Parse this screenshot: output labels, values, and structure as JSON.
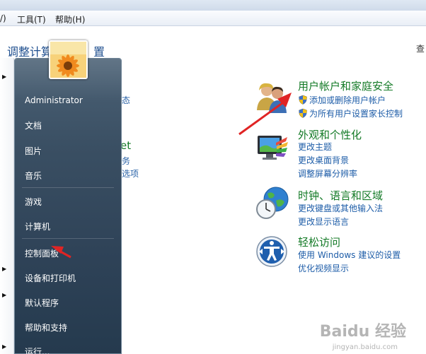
{
  "menubar": {
    "view_fragment": "/)",
    "tools": "工具(T)",
    "help": "帮助(H)"
  },
  "page": {
    "title_left": "调整计算",
    "title_right": "置",
    "right_edge_glyph": "查"
  },
  "categories": [
    {
      "title": "用户帐户和家庭安全",
      "icon": "users-icon",
      "links": [
        "添加或删除用户帐户",
        "为所有用户设置家长控制"
      ],
      "shield_links": true
    },
    {
      "title": "外观和个性化",
      "icon": "appearance-icon",
      "links": [
        "更改主题",
        "更改桌面背景",
        "调整屏幕分辨率"
      ],
      "shield_links": false
    },
    {
      "title": "时钟、语言和区域",
      "icon": "clock-globe-icon",
      "links": [
        "更改键盘或其他输入法",
        "更改显示语言"
      ],
      "shield_links": false
    },
    {
      "title": "轻松访问",
      "icon": "ease-of-access-icon",
      "links": [
        "使用 Windows 建议的设置",
        "优化视频显示"
      ],
      "shield_links": false
    }
  ],
  "behind_menu": {
    "link1": "态",
    "title2": "et",
    "link2": "务",
    "link3": "选项"
  },
  "start_menu": {
    "items": [
      "Administrator",
      "文档",
      "图片",
      "音乐",
      "游戏",
      "计算机",
      "控制面板",
      "设备和打印机",
      "默认程序",
      "帮助和支持",
      "运行..."
    ]
  },
  "watermark": {
    "main": "Baidu 经验",
    "sub": "jingyan.baidu.com"
  },
  "colors": {
    "category_title": "#137a26",
    "link": "#1e5da8",
    "annotation_arrow": "#e02424"
  }
}
